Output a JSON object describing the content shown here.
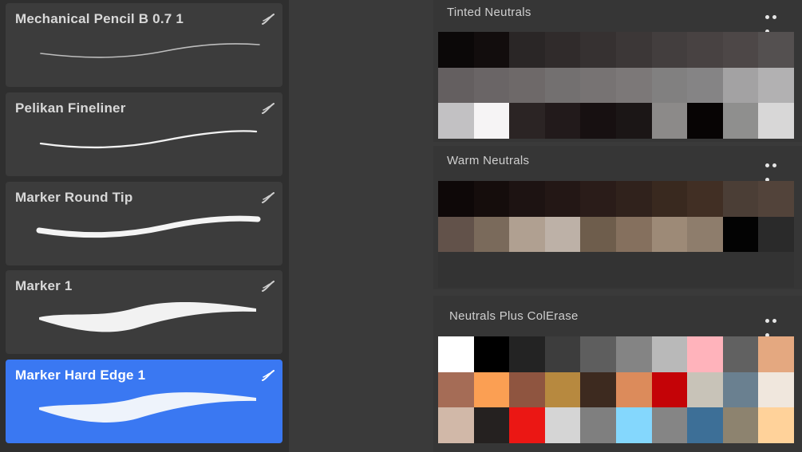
{
  "brushes": [
    {
      "name": "Mechanical Pencil B 0.7 1",
      "stroke": "pencil",
      "selected": false
    },
    {
      "name": "Pelikan Fineliner",
      "stroke": "fineliner",
      "selected": false
    },
    {
      "name": "Marker Round Tip",
      "stroke": "round-tip",
      "selected": false
    },
    {
      "name": "Marker 1",
      "stroke": "marker",
      "selected": false
    },
    {
      "name": "Marker Hard Edge 1",
      "stroke": "hard-edge",
      "selected": true
    }
  ],
  "brush_icon": "brush-stroke-icon",
  "palettes": [
    {
      "title": "Tinted Neutrals",
      "menu_icon": "more-dots-icon",
      "colors": [
        "#0b0808",
        "#120d0d",
        "#2a2626",
        "#302b2b",
        "#363131",
        "#3c3737",
        "#433e3e",
        "#484242",
        "#4d4747",
        "#545050",
        "#645f60",
        "#6a6566",
        "#6e6969",
        "#737070",
        "#777373",
        "#7c7878",
        "#818080",
        "#858485",
        "#a3a2a3",
        "#b2b1b2",
        "#c2c1c3",
        "#f6f4f5",
        "#2b2424",
        "#221a1b",
        "#171011",
        "#1b1616",
        "#8c8a89",
        "#070404",
        "#8f8f8e",
        "#d8d7d7"
      ]
    },
    {
      "title": "Warm Neutrals",
      "menu_icon": "more-dots-icon",
      "colors": [
        "#0e0808",
        "#150d0c",
        "#1d1312",
        "#231715",
        "#2a1c19",
        "#30221c",
        "#39291f",
        "#412f24",
        "#4b3e36",
        "#52433a",
        "#62524a",
        "#7a6a5b",
        "#b0a091",
        "#bdb1a7",
        "#6e5d4c",
        "#85705e",
        "#9d8a77",
        "#8e7d6c",
        "#030303",
        "#2a2a2a",
        "#333333",
        "#333333",
        "#333333",
        "#333333",
        "#333333",
        "#333333",
        "#333333",
        "#333333",
        "#333333",
        "#333333"
      ]
    },
    {
      "title": "Neutrals Plus ColErase",
      "menu_icon": "more-dots-icon",
      "colors": [
        "#ffffff",
        "#000000",
        "#232323",
        "#3d3d3d",
        "#5e5e5e",
        "#848484",
        "#b9b9b9",
        "#ffb3bb",
        "#616161",
        "#e4a880",
        "#a56c56",
        "#fb9f53",
        "#8f5540",
        "#b7893f",
        "#3d2a1f",
        "#dc8b5b",
        "#c40307",
        "#c8c3b8",
        "#6a8090",
        "#f0e7dd",
        "#d1b8a8",
        "#252120",
        "#eb1714",
        "#d5d5d5",
        "#7f7f7f",
        "#84d7fd",
        "#858585",
        "#3d6f97",
        "#8d836f",
        "#ffd29a"
      ]
    }
  ]
}
